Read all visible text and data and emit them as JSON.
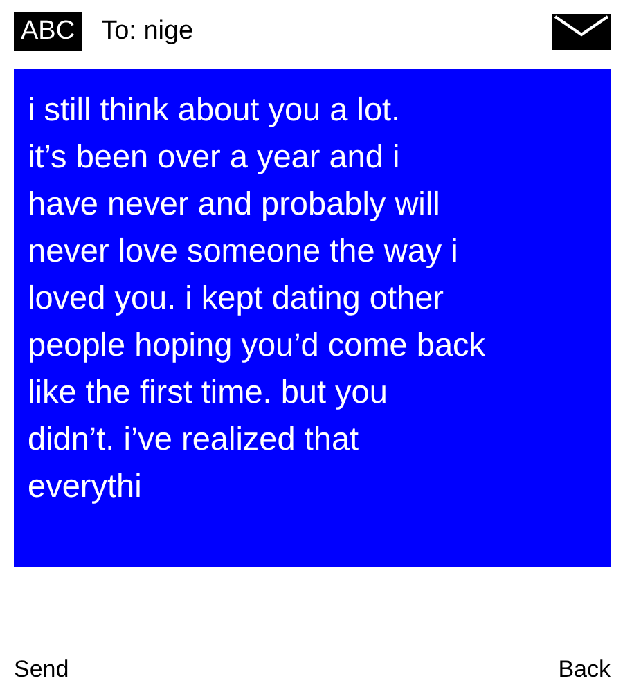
{
  "header": {
    "mode": "ABC",
    "recipient": "To: nige"
  },
  "message": {
    "lines": [
      "i still think about you a lot.",
      "it’s been over a year and i",
      "have never and probably will",
      "never love someone the way i",
      "loved you. i kept dating other",
      "people hoping you’d come back",
      "like the first time. but you",
      "didn’t. i’ve realized that",
      "everythi"
    ]
  },
  "softkeys": {
    "left": "Send",
    "right": "Back"
  }
}
